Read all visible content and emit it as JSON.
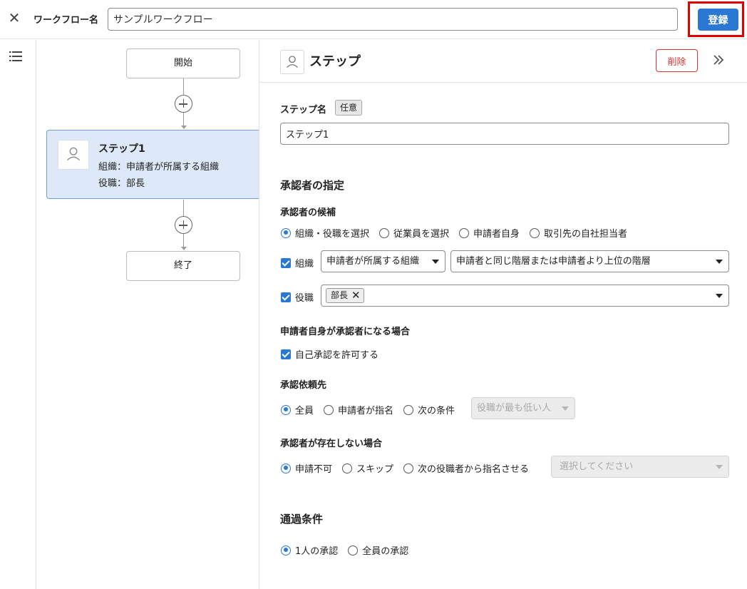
{
  "header": {
    "close_icon": "close-icon",
    "workflow_name_label": "ワークフロー名",
    "workflow_name_value": "サンプルワークフロー",
    "register_label": "登録",
    "register_highlight_color": "#e10000"
  },
  "sidebar": {
    "menu_icon": "list-icon"
  },
  "flow": {
    "start_label": "開始",
    "end_label": "終了",
    "step": {
      "title": "ステップ1",
      "org_line": "組織：申請者が所属する組織",
      "role_line": "役職：部長"
    }
  },
  "panel": {
    "title": "ステップ",
    "delete_label": "削除",
    "collapse_icon": "double-chevron-right-icon",
    "step_name_label": "ステップ名",
    "optional_badge": "任意",
    "step_name_value": "ステップ1",
    "approver_section": "承認者の指定",
    "candidates_label": "承認者の候補",
    "candidate_options": [
      "組織・役職を選択",
      "従業員を選択",
      "申請者自身",
      "取引先の自社担当者"
    ],
    "candidate_selected": 0,
    "org_label": "組織",
    "org_select_value": "申請者が所属する組織",
    "hierarchy_select_value": "申請者と同じ階層または申請者より上位の階層",
    "role_label": "役職",
    "role_chip": "部長",
    "self_label": "申請者自身が承認者になる場合",
    "self_checkbox": "自己承認を許可する",
    "request_label": "承認依頼先",
    "request_options": [
      "全員",
      "申請者が指名",
      "次の条件"
    ],
    "request_selected": 0,
    "request_condition_value": "役職が最も低い人",
    "absent_label": "承認者が存在しない場合",
    "absent_options": [
      "申請不可",
      "スキップ",
      "次の役職者から指名させる"
    ],
    "absent_selected": 0,
    "absent_select_placeholder": "選択してください",
    "pass_section": "通過条件",
    "pass_options": [
      "1人の承認",
      "全員の承認"
    ],
    "pass_selected": 0
  },
  "colors": {
    "accent": "#2b78d4",
    "danger": "#dd3333",
    "step_bg": "#dde9f8"
  }
}
